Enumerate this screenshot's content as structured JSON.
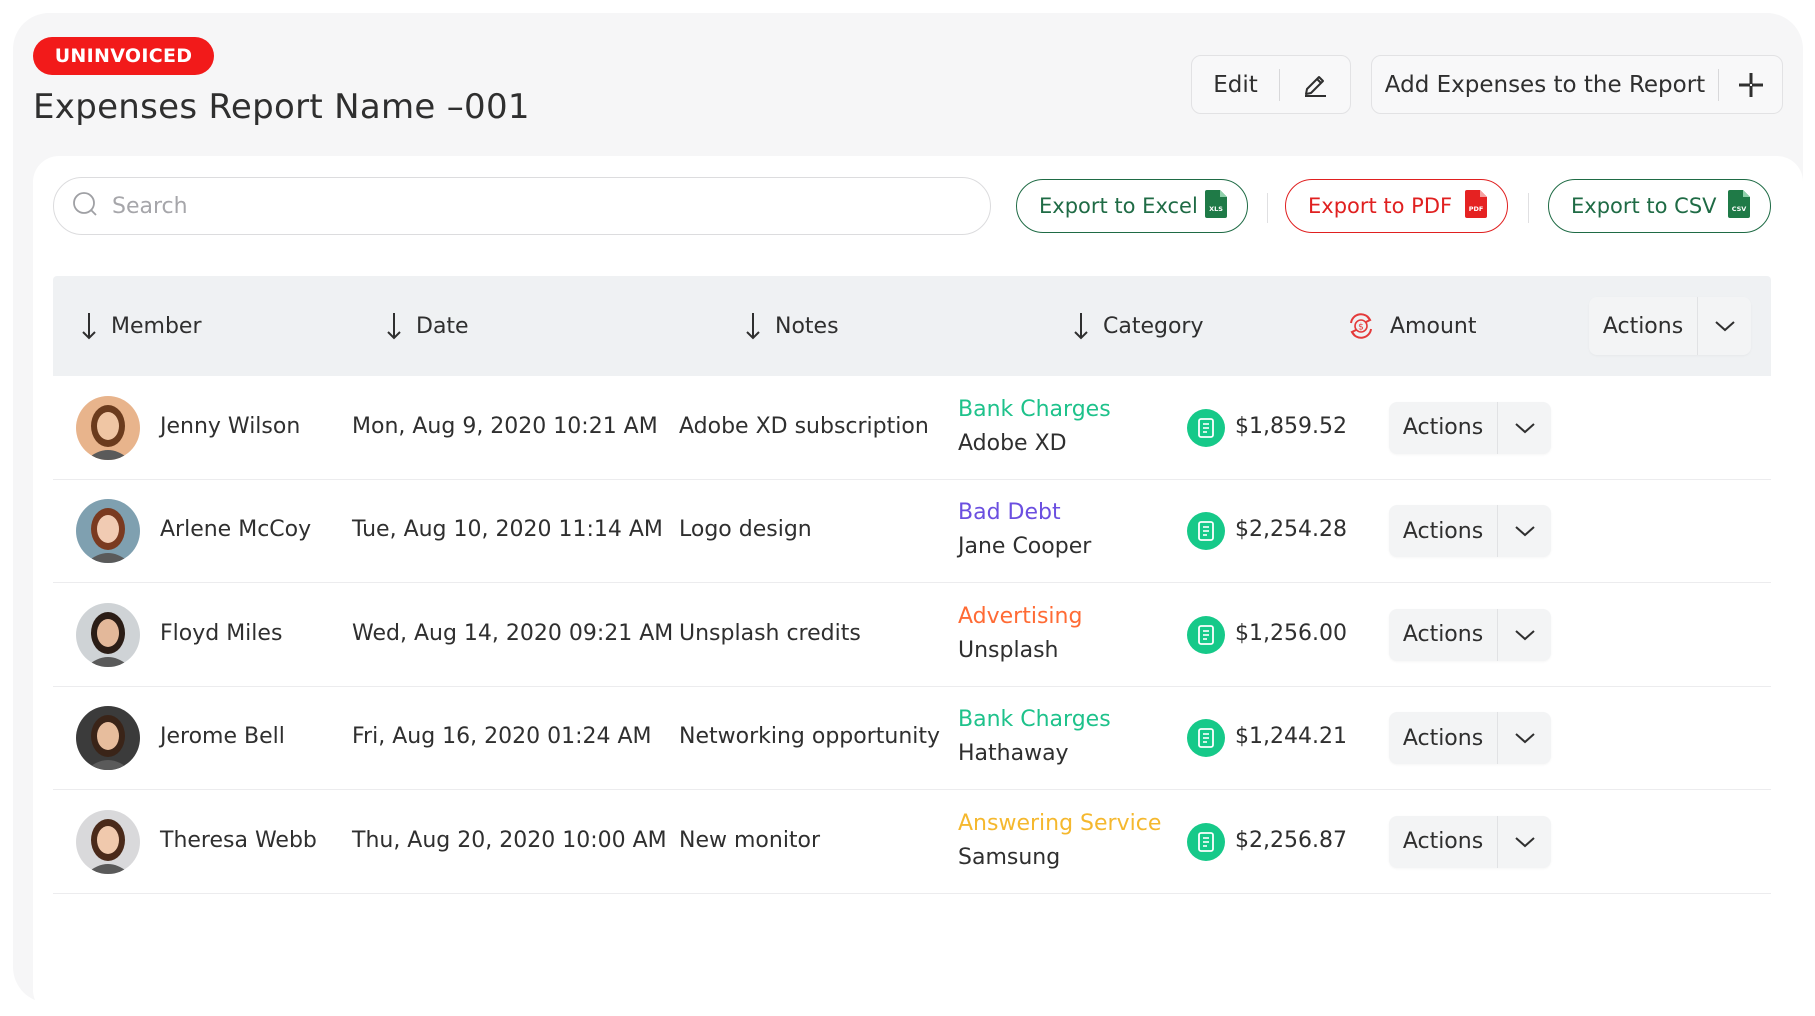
{
  "header": {
    "status_badge": "UNINVOICED",
    "title": "Expenses Report Name –001",
    "edit_label": "Edit",
    "add_label": "Add Expenses to the Report"
  },
  "toolbar": {
    "search_placeholder": "Search",
    "export_excel": "Export to Excel",
    "export_pdf": "Export to PDF",
    "export_csv": "Export to CSV",
    "excel_badge": "XLS",
    "pdf_badge": "PDF",
    "csv_badge": "CSV"
  },
  "table": {
    "columns": {
      "member": "Member",
      "date": "Date",
      "notes": "Notes",
      "category": "Category",
      "amount": "Amount",
      "actions": "Actions"
    },
    "rows": [
      {
        "member": "Jenny Wilson",
        "date": "Mon, Aug 9, 2020 10:21 AM",
        "notes": "Adobe XD subscription",
        "category": "Bank Charges",
        "category_color": "#1ec28b",
        "vendor": "Adobe XD",
        "amount": "$1,859.52",
        "actions": "Actions"
      },
      {
        "member": "Arlene McCoy",
        "date": "Tue, Aug 10, 2020 11:14 AM",
        "notes": "Logo design",
        "category": "Bad Debt",
        "category_color": "#6b4fe0",
        "vendor": "Jane Cooper",
        "amount": "$2,254.28",
        "actions": "Actions"
      },
      {
        "member": "Floyd Miles",
        "date": "Wed, Aug 14, 2020 09:21 AM",
        "notes": "Unsplash credits",
        "category": "Advertising",
        "category_color": "#ff6b35",
        "vendor": "Unsplash",
        "amount": "$1,256.00",
        "actions": "Actions"
      },
      {
        "member": "Jerome Bell",
        "date": "Fri, Aug 16, 2020 01:24 AM",
        "notes": "Networking opportunity",
        "category": "Bank Charges",
        "category_color": "#1ec28b",
        "vendor": "Hathaway",
        "amount": "$1,244.21",
        "actions": "Actions"
      },
      {
        "member": "Theresa Webb",
        "date": "Thu, Aug 20, 2020 10:00 AM",
        "notes": "New monitor",
        "category": "Answering Service",
        "category_color": "#f5b82e",
        "vendor": "Samsung",
        "amount": "$2,256.87",
        "actions": "Actions"
      }
    ]
  },
  "colors": {
    "badge": "#f21a1a",
    "excel": "#1f6b45",
    "pdf": "#e02020",
    "amount_icon": "#16c989"
  },
  "icons": [
    "search-icon",
    "pencil-icon",
    "plus-icon",
    "excel-file-icon",
    "pdf-file-icon",
    "csv-file-icon",
    "sort-arrow-down-icon",
    "dollar-cycle-icon",
    "chevron-down-icon",
    "receipt-icon"
  ]
}
